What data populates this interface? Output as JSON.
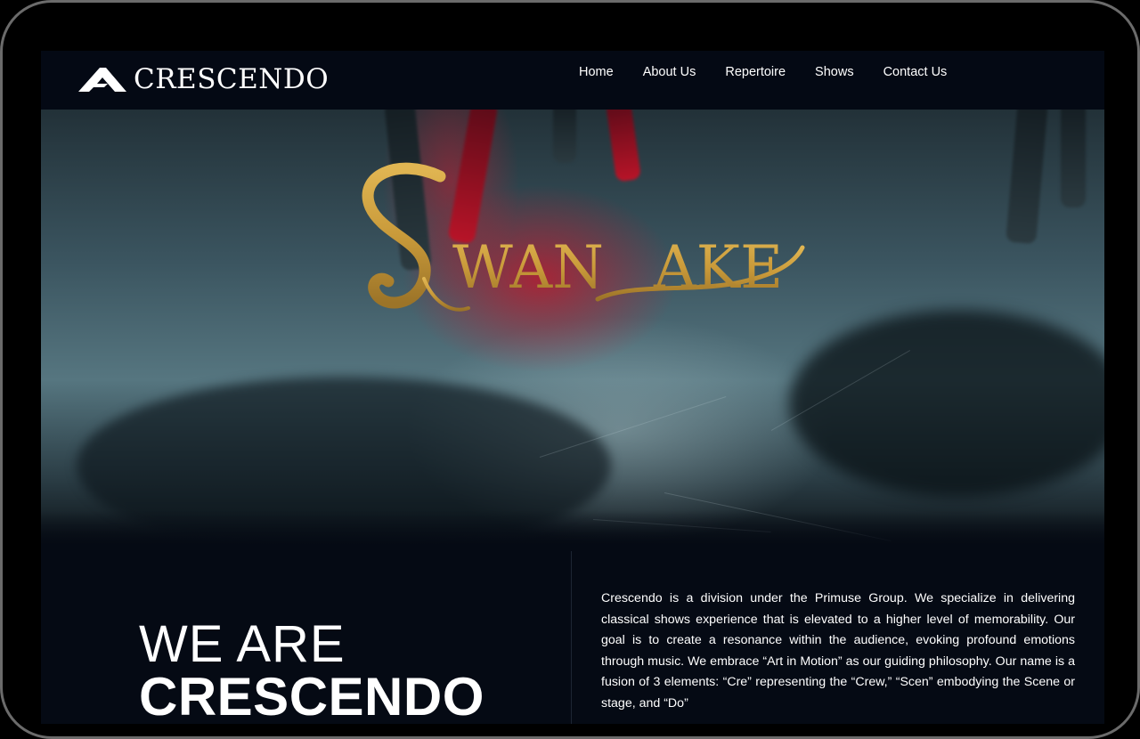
{
  "brand": {
    "logo_text": "CRESCENDO",
    "logo_icon": "mountain-chevron-icon"
  },
  "nav": {
    "items": [
      {
        "label": "Home"
      },
      {
        "label": "About Us"
      },
      {
        "label": "Repertoire"
      },
      {
        "label": "Shows"
      },
      {
        "label": "Contact Us"
      }
    ]
  },
  "hero": {
    "show_title": "SWAN LAKE",
    "show_title_color": "#C99A3A"
  },
  "about": {
    "heading_light": "WE ARE",
    "heading_bold": "CRESCENDO",
    "body": "Crescendo is a division under the Primuse Group. We specialize in delivering classical shows experience that is elevated to a higher level of memorability. Our goal is to create a resonance within the audience, evoking profound emotions through music. We embrace “Art in Motion” as our guiding philosophy. Our name is a fusion of 3 elements: “Cre” representing the “Crew,” “Scen” embodying the Scene or stage, and “Do”"
  },
  "colors": {
    "page_background": "#050A14",
    "nav_background": "#040914",
    "text": "#FFFFFF",
    "accent_gold": "#C99A3A",
    "hero_red": "#B81428"
  }
}
